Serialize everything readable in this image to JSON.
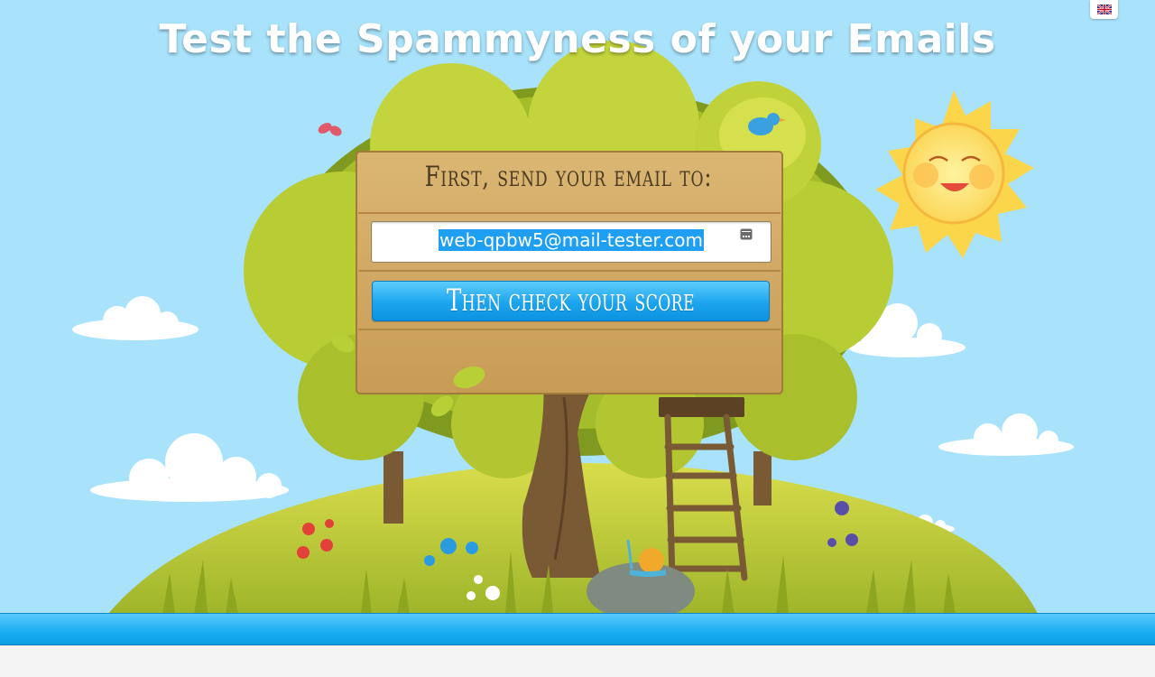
{
  "page": {
    "title": "Test the Spammyness of your Emails",
    "language_icon": "uk-flag-icon"
  },
  "sign": {
    "heading": "First, send your email to:",
    "email": "web-qpbw5@mail-tester.com",
    "copy_icon": "copy-icon",
    "button_label": "Then check your score"
  },
  "colors": {
    "sky": "#a8e2fb",
    "button_blue": "#1ca4ee",
    "bar_blue": "#19aef2"
  }
}
